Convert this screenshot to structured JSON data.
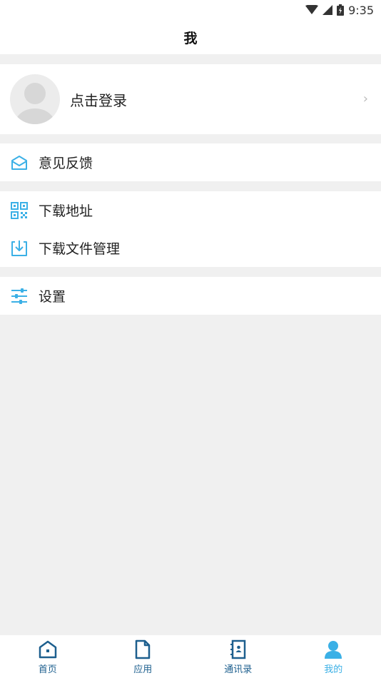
{
  "status_bar": {
    "time": "9:35"
  },
  "header": {
    "title": "我"
  },
  "profile": {
    "login_label": "点击登录",
    "chevron": "›"
  },
  "menu_groups": [
    {
      "items": [
        {
          "label": "意见反馈",
          "icon": "envelope-icon"
        }
      ]
    },
    {
      "items": [
        {
          "label": "下载地址",
          "icon": "qr-code-icon"
        },
        {
          "label": "下载文件管理",
          "icon": "download-icon"
        }
      ]
    },
    {
      "items": [
        {
          "label": "设置",
          "icon": "sliders-icon"
        }
      ]
    }
  ],
  "tab_bar": {
    "tabs": [
      {
        "label": "首页",
        "icon": "home-icon",
        "active": false
      },
      {
        "label": "应用",
        "icon": "file-icon",
        "active": false
      },
      {
        "label": "通讯录",
        "icon": "contacts-icon",
        "active": false
      },
      {
        "label": "我的",
        "icon": "person-icon",
        "active": true
      }
    ]
  },
  "colors": {
    "accent": "#3bb0e6",
    "tab_inactive": "#1d5f8e",
    "background": "#f0f0f0"
  }
}
